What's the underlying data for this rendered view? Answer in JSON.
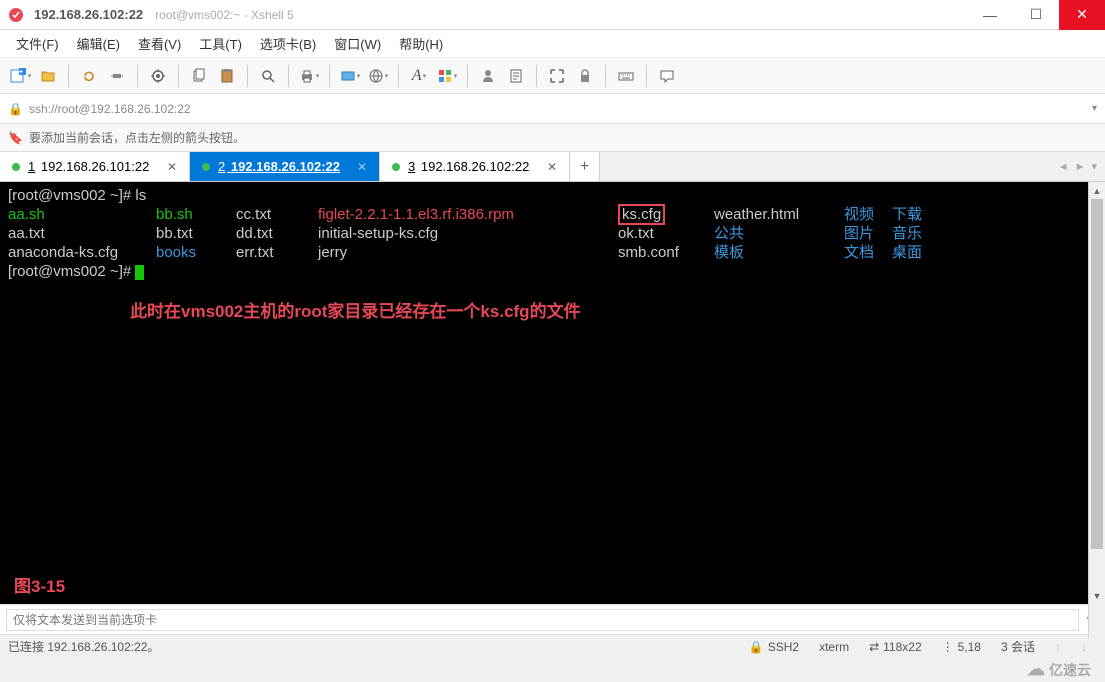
{
  "window": {
    "title": "192.168.26.102:22",
    "subtitle": "root@vms002:~ - Xshell 5"
  },
  "menu": [
    "文件(F)",
    "编辑(E)",
    "查看(V)",
    "工具(T)",
    "选项卡(B)",
    "窗口(W)",
    "帮助(H)"
  ],
  "address": {
    "url": "ssh://root@192.168.26.102:22"
  },
  "hint": "要添加当前会话，点击左侧的箭头按钮。",
  "tabs": [
    {
      "num": "1",
      "label": "192.168.26.101:22",
      "active": false
    },
    {
      "num": "2",
      "label": "192.168.26.102:22",
      "active": true
    },
    {
      "num": "3",
      "label": "192.168.26.102:22",
      "active": false
    }
  ],
  "terminal": {
    "prompt": "[root@vms002 ~]#",
    "cmd": "ls",
    "rows": [
      [
        "aa.sh",
        "bb.sh",
        "cc.txt",
        "figlet-2.2.1-1.1.el3.rf.i386.rpm",
        "ks.cfg",
        "weather.html",
        "视频",
        "下载"
      ],
      [
        "aa.txt",
        "bb.txt",
        "dd.txt",
        "initial-setup-ks.cfg",
        "ok.txt",
        "公共",
        "图片",
        "音乐"
      ],
      [
        "anaconda-ks.cfg",
        "books",
        "err.txt",
        "jerry",
        "smb.conf",
        "模板",
        "文档",
        "桌面"
      ]
    ],
    "annotation": "此时在vms002主机的root家目录已经存在一个ks.cfg的文件",
    "figure_label": "图3-15"
  },
  "sendbar": {
    "placeholder": "仅将文本发送到当前选项卡"
  },
  "status": {
    "connected": "已连接 192.168.26.102:22。",
    "protocol": "SSH2",
    "term": "xterm",
    "size": "118x22",
    "cursor": "5,18",
    "sessions": "3 会话"
  },
  "watermark": "亿速云",
  "colors": {
    "green": "#16c60c",
    "red": "#e74856",
    "blue": "#3a96dd",
    "tab_active": "#0078d7"
  }
}
